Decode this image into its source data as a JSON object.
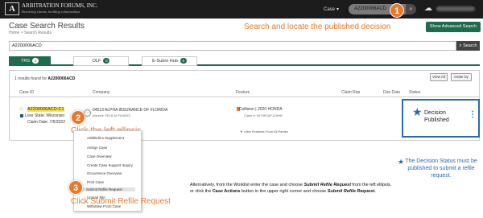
{
  "header": {
    "logo_mark": "A",
    "logo_name": "ARBITRATION FORUMS, INC.",
    "logo_tagline": "Resolving claims, building relationships",
    "search_type": "Case",
    "search_value": "A2200006ACD",
    "search_icon": "search-icon",
    "cloud_icon": "cloud-icon"
  },
  "callouts": [
    {
      "num": "1",
      "text": "Search and locate the published decision"
    },
    {
      "num": "2",
      "text": "Click the left ellipsis"
    },
    {
      "num": "3",
      "text": "Click Submit Refile Request"
    }
  ],
  "page": {
    "title": "Case Search Results",
    "breadcrumb": "Home  >  Search Results",
    "advanced_search_label": "Show Advanced Search",
    "search_value": "A2200006ACD",
    "search_button_label": "Search"
  },
  "tabs": [
    {
      "label": "TRS",
      "count": "1"
    },
    {
      "label": "OLF",
      "count": "0"
    },
    {
      "label": "E-Subro Hub",
      "count": "0"
    }
  ],
  "results": {
    "count_prefix": "1 results found for",
    "count_query": "A2200006ACD",
    "view_all_label": "View All",
    "order_by_label": "Order by",
    "columns": [
      "Case ID",
      "Company",
      "Feature",
      "Claim Rep",
      "Due Date",
      "Status"
    ],
    "row": {
      "case_id": "A2200006ACD-C1",
      "loss_state": "Loss State: Wisconsin",
      "claim_date": "Claim Date: 7/5/2022",
      "company": "04513 ALPHA INSURANCE OF FLORIDA",
      "insured": "Insured: FELICIA FILBOIS",
      "feature": "Collision | 2020 HONDA",
      "feature_sub": "Claim #: 9473HG8712AHB",
      "view_features": "View Features From All Parties",
      "status": "Decision Published",
      "kebab": "⋮"
    }
  },
  "menu": {
    "items": [
      "Add/Edit a Supplement",
      "Assign Case",
      "Case Overview",
      "Create Case Support Inquiry",
      "Occurrence Overview",
      "Print Case",
      "Submit Refile Request",
      "Upload File",
      "Withdraw From Case"
    ]
  },
  "notes": {
    "instruction_1": "Alternatively, from the Worklist enter the case and choose ",
    "instruction_2": "Submit Refile Request",
    "instruction_3": " from the left ellipsis, or click the ",
    "instruction_4": "Case Actions",
    "instruction_5": " button in the upper right corner and choose ",
    "instruction_6": "Submit Refile Request.",
    "side": "The Decision Status must be published to submit a refile request."
  },
  "colors": {
    "accent_orange": "#e8782a",
    "brand_green": "#1f6b4e",
    "highlight_blue": "#2a6ab0"
  }
}
